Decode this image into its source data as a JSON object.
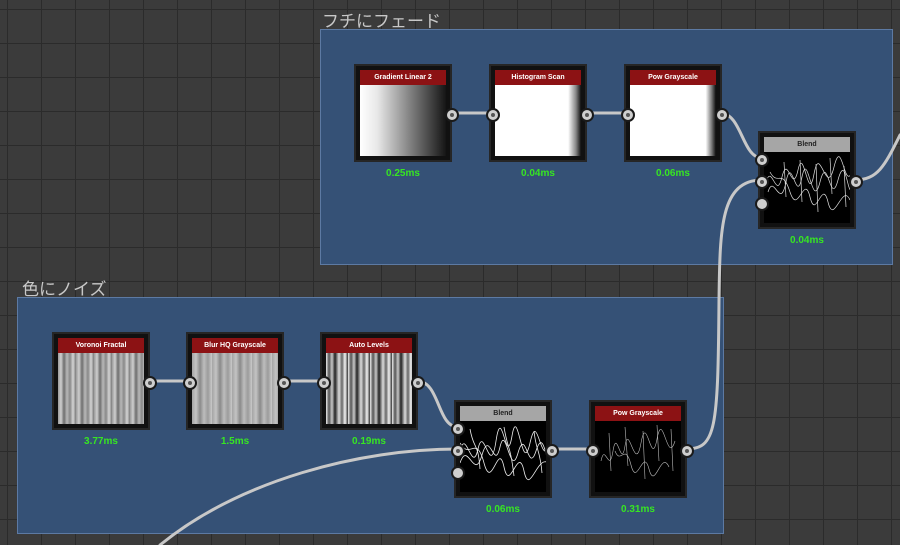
{
  "frames": [
    {
      "title": "フチにフェード"
    },
    {
      "title": "色にノイズ"
    }
  ],
  "nodes": {
    "gradient_linear": {
      "label": "Gradient Linear 2",
      "time": "0.25ms"
    },
    "histogram_scan": {
      "label": "Histogram Scan",
      "time": "0.04ms"
    },
    "pow_grayscale_top": {
      "label": "Pow Grayscale",
      "time": "0.06ms"
    },
    "blend_top": {
      "label": "Blend",
      "time": "0.04ms"
    },
    "voronoi_fractal": {
      "label": "Voronoi Fractal",
      "time": "3.77ms"
    },
    "blur_hq": {
      "label": "Blur HQ Grayscale",
      "time": "1.5ms"
    },
    "auto_levels": {
      "label": "Auto Levels",
      "time": "0.19ms"
    },
    "blend_bottom": {
      "label": "Blend",
      "time": "0.06ms"
    },
    "pow_grayscale_bottom": {
      "label": "Pow Grayscale",
      "time": "0.31ms"
    }
  },
  "colors": {
    "frame": "#355176",
    "header_red": "#8c1214",
    "header_gray": "#a6a6a6",
    "time_green": "#37e622",
    "wire": "#c8c8c8"
  }
}
